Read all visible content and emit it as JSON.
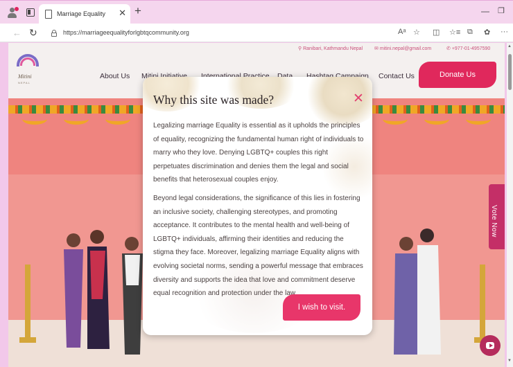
{
  "browser": {
    "tab_title": "Marriage Equality",
    "url": "https://marriageequalityforlgbtqcommunity.org"
  },
  "site": {
    "logo_text": "Mitini",
    "logo_sub": "NEPAL",
    "contact": {
      "location": "Ranibari, Kathmandu Nepal",
      "email": "mitini.nepal@gmail.com",
      "phone": "+977-01-4957590"
    },
    "nav": [
      "About Us",
      "Mitini Initiative",
      "International Practice",
      "Data",
      "Hashtag Campaign",
      "Contact Us"
    ],
    "donate_label": "Donate Us",
    "vote_label": "Vote Now"
  },
  "modal": {
    "title": "Why this site was made?",
    "paragraph1": "Legalizing marriage Equality is essential as it upholds the principles of equality, recognizing the fundamental human right of individuals to marry who they love. Denying LGBTQ+ couples this right perpetuates discrimination and denies them the legal and social benefits that heterosexual couples enjoy.",
    "paragraph2": "Beyond legal considerations, the significance of this lies in fostering an inclusive society, challenging stereotypes, and promoting acceptance. It contributes to the mental health and well-being of LGBTQ+ individuals, affirming their identities and reducing the stigma they face. Moreover, legalizing marriage Equality aligns with evolving societal norms, sending a powerful message that embraces diversity and supports the idea that love and commitment deserve equal recognition and protection under the law",
    "visit_button": "I wish to visit."
  },
  "colors": {
    "accent": "#e8366a",
    "hero": "#ef847f",
    "browser_frame": "#f5d6ee"
  }
}
